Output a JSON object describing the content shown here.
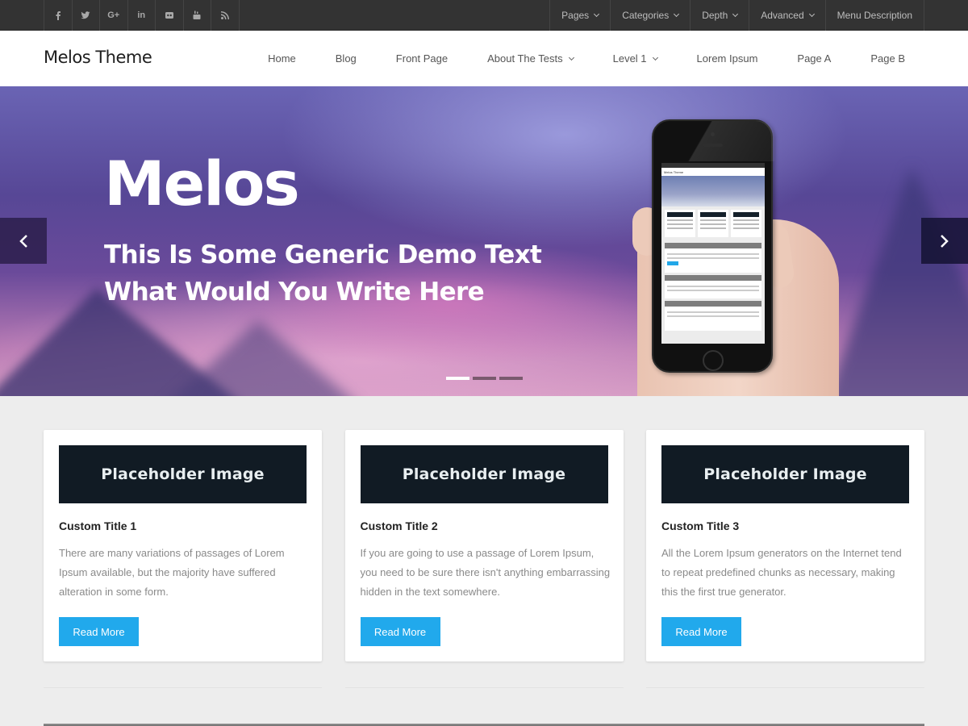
{
  "topbar": {
    "social": [
      {
        "name": "facebook",
        "glyph": "f"
      },
      {
        "name": "twitter",
        "glyph": "t"
      },
      {
        "name": "google-plus",
        "glyph": "G+"
      },
      {
        "name": "linkedin",
        "glyph": "in"
      },
      {
        "name": "flickr",
        "glyph": "••"
      },
      {
        "name": "youtube",
        "glyph": "yt"
      },
      {
        "name": "rss",
        "glyph": "rss"
      }
    ],
    "menu": [
      {
        "label": "Pages",
        "has_dropdown": true
      },
      {
        "label": "Categories",
        "has_dropdown": true
      },
      {
        "label": "Depth",
        "has_dropdown": true
      },
      {
        "label": "Advanced",
        "has_dropdown": true
      },
      {
        "label": "Menu Description",
        "has_dropdown": false
      }
    ]
  },
  "header": {
    "site_title": "Melos Theme",
    "nav": [
      {
        "label": "Home",
        "has_dropdown": false
      },
      {
        "label": "Blog",
        "has_dropdown": false
      },
      {
        "label": "Front Page",
        "has_dropdown": false
      },
      {
        "label": "About The Tests",
        "has_dropdown": true
      },
      {
        "label": "Level 1",
        "has_dropdown": true
      },
      {
        "label": "Lorem Ipsum",
        "has_dropdown": false
      },
      {
        "label": "Page A",
        "has_dropdown": false
      },
      {
        "label": "Page B",
        "has_dropdown": false
      }
    ]
  },
  "hero": {
    "title": "Melos",
    "subtitle_line1": "This Is Some Generic Demo Text",
    "subtitle_line2": "What Would You Write Here",
    "prev_icon": "chevron-left-icon",
    "next_icon": "chevron-right-icon",
    "slides_total": 3,
    "active_slide": 1,
    "phone_screen_title": "Melos Theme"
  },
  "cards": [
    {
      "image_label": "Placeholder Image",
      "title": "Custom Title 1",
      "text": "There are many variations of passages of Lorem Ipsum available, but the majority have suffered alteration in some form.",
      "button": "Read More"
    },
    {
      "image_label": "Placeholder Image",
      "title": "Custom Title 2",
      "text": "If you are going to use a passage of Lorem Ipsum, you need to be sure there isn't anything embarrassing hidden in the text somewhere.",
      "button": "Read More"
    },
    {
      "image_label": "Placeholder Image",
      "title": "Custom Title 3",
      "text": "All the Lorem Ipsum generators on the Internet tend to repeat predefined chunks as necessary, making this the first true generator.",
      "button": "Read More"
    }
  ],
  "colors": {
    "topbar_bg": "#333333",
    "accent_button": "#21a9ec",
    "placeholder_bg": "#111b24",
    "page_bg": "#ededed"
  }
}
